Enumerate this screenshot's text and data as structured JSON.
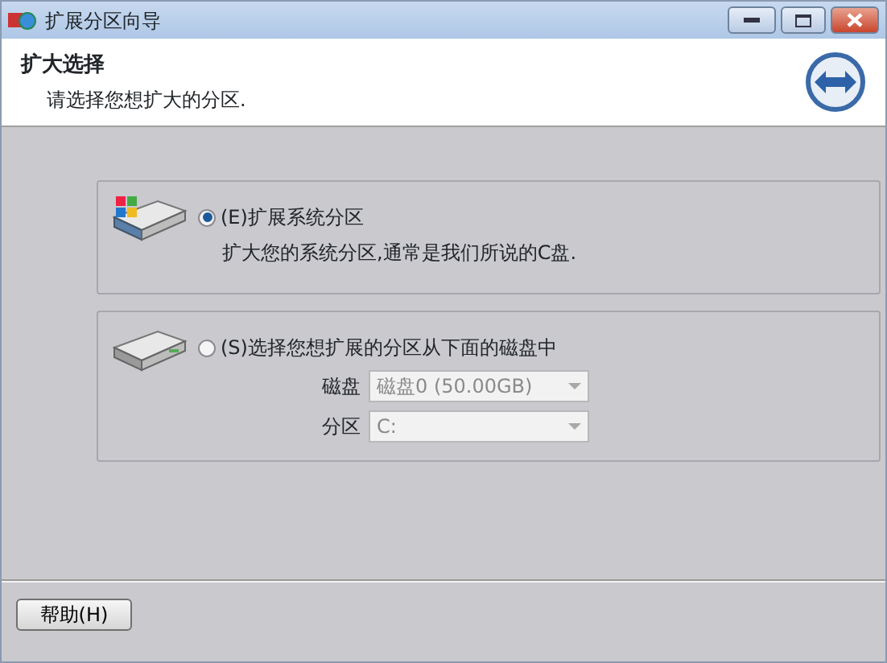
{
  "window": {
    "title": "扩展分区向导"
  },
  "header": {
    "title": "扩大选择",
    "subtitle": "请选择您想扩大的分区."
  },
  "options": [
    {
      "label": "(E)扩展系统分区",
      "description": "扩大您的系统分区,通常是我们所说的C盘.",
      "selected": true
    },
    {
      "label": "(S)选择您想扩展的分区从下面的磁盘中",
      "selected": false,
      "fields": [
        {
          "label": "磁盘",
          "value": "磁盘0 (50.00GB)",
          "disabled": true
        },
        {
          "label": "分区",
          "value": "C:",
          "disabled": true
        }
      ]
    }
  ],
  "buttons": [
    {
      "label": "帮助(H)"
    }
  ]
}
